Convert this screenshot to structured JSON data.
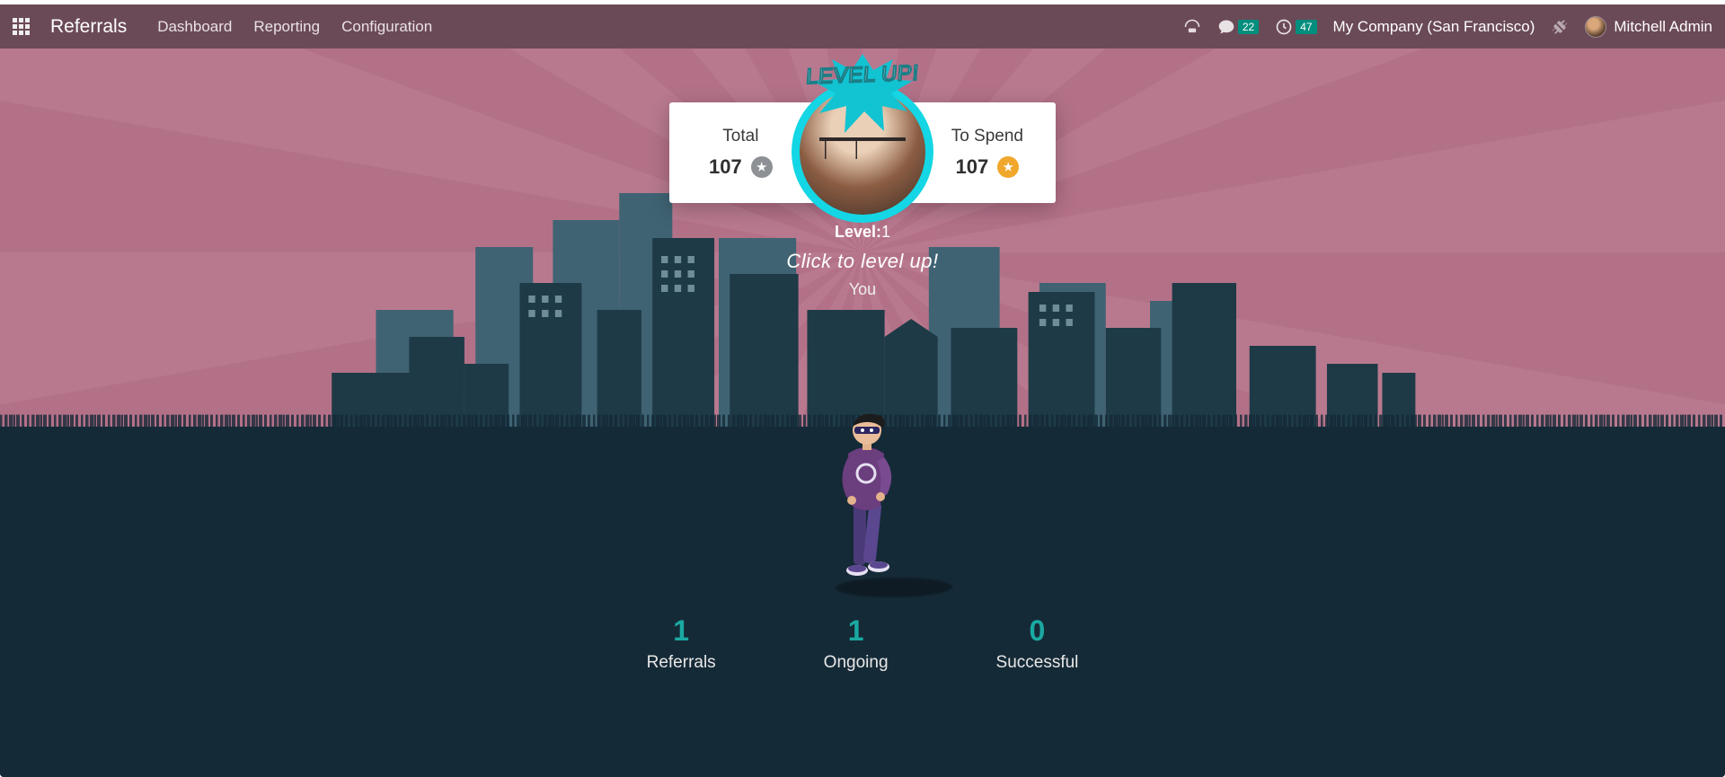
{
  "navbar": {
    "brand": "Referrals",
    "links": {
      "dashboard": "Dashboard",
      "reporting": "Reporting",
      "configuration": "Configuration"
    },
    "messages_badge": "22",
    "activities_badge": "47",
    "company": "My Company (San Francisco)",
    "user_name": "Mitchell Admin"
  },
  "points": {
    "total_label": "Total",
    "total_value": "107",
    "spend_label": "To Spend",
    "spend_value": "107"
  },
  "level": {
    "levelup_text": "LEVEL UP!",
    "level_prefix": "Level:",
    "level_value": "1",
    "click_text": "Click to level up!",
    "you_label": "You"
  },
  "stats": {
    "referrals_num": "1",
    "referrals_label": "Referrals",
    "ongoing_num": "1",
    "ongoing_label": "Ongoing",
    "successful_num": "0",
    "successful_label": "Successful"
  }
}
